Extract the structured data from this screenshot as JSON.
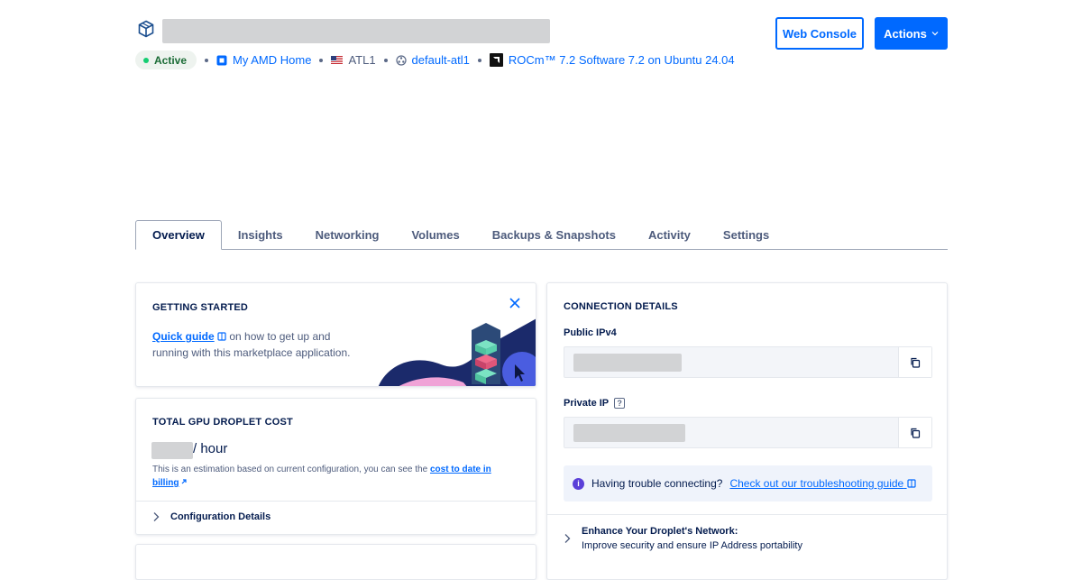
{
  "header": {
    "web_console_label": "Web Console",
    "actions_label": "Actions",
    "status": "Active",
    "project": "My AMD Home",
    "region": "ATL1",
    "vpc": "default-atl1",
    "image": "ROCm™ 7.2 Software 7.2 on Ubuntu 24.04"
  },
  "tabs": [
    "Overview",
    "Insights",
    "Networking",
    "Volumes",
    "Backups & Snapshots",
    "Activity",
    "Settings"
  ],
  "getting_started": {
    "title": "GETTING STARTED",
    "quick_guide": "Quick guide",
    "text_after_link": " on how to get up and running with this marketplace application."
  },
  "cost": {
    "title": "TOTAL GPU DROPLET COST",
    "unit": "/ hour",
    "note": "This is an estimation based on current configuration, you can see the ",
    "note_link": "cost to date in billing",
    "config_details": "Configuration Details"
  },
  "connection": {
    "title": "CONNECTION DETAILS",
    "public_label": "Public IPv4",
    "private_label": "Private IP",
    "help_glyph": "?",
    "trouble_text": "Having trouble connecting?",
    "trouble_link": "Check out our troubleshooting guide",
    "enhance_title": "Enhance Your Droplet's Network:",
    "enhance_sub": "Improve security and ensure IP Address portability"
  },
  "colors": {
    "brand_blue": "#0069ff",
    "navy_text": "#031b4e",
    "status_green": "#15cd72"
  }
}
